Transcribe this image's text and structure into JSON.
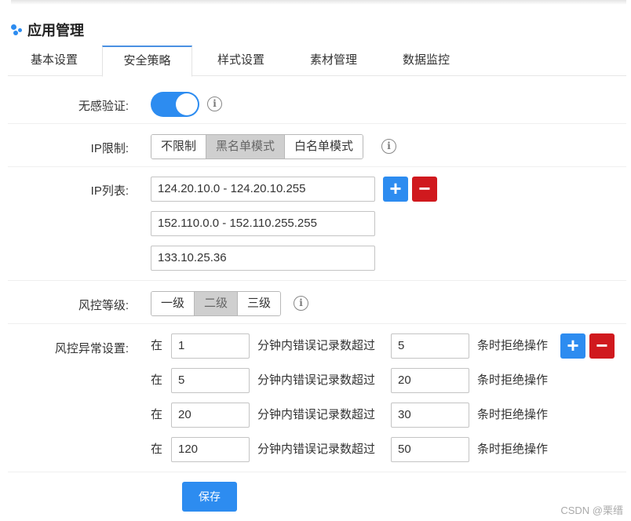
{
  "app": {
    "title": "应用管理"
  },
  "tabs": [
    {
      "label": "基本设置",
      "active": false
    },
    {
      "label": "安全策略",
      "active": true
    },
    {
      "label": "样式设置",
      "active": false
    },
    {
      "label": "素材管理",
      "active": false
    },
    {
      "label": "数据监控",
      "active": false
    }
  ],
  "form": {
    "seamless_verification": {
      "label": "无感验证:",
      "enabled": true
    },
    "ip_restriction": {
      "label": "IP限制:",
      "options": [
        "不限制",
        "黑名单模式",
        "白名单模式"
      ],
      "selected": "黑名单模式"
    },
    "ip_list": {
      "label": "IP列表:",
      "entries": [
        "124.20.10.0 - 124.20.10.255",
        "152.110.0.0 - 152.110.255.255",
        "133.10.25.36"
      ]
    },
    "risk_level": {
      "label": "风控等级:",
      "options": [
        "一级",
        "二级",
        "三级"
      ],
      "selected": "二级"
    },
    "risk_anomaly": {
      "label": "风控异常设置:",
      "prefix": "在",
      "middle": "分钟内错误记录数超过",
      "suffix": "条时拒绝操作",
      "rules": [
        {
          "minutes": "1",
          "count": "5"
        },
        {
          "minutes": "5",
          "count": "20"
        },
        {
          "minutes": "20",
          "count": "30"
        },
        {
          "minutes": "120",
          "count": "50"
        }
      ]
    }
  },
  "actions": {
    "save_label": "保存",
    "add_symbol": "+",
    "remove_symbol": "−"
  },
  "info_symbol": "i",
  "watermark": "CSDN @栗缙",
  "colors": {
    "primary": "#2d8cf0",
    "danger": "#d0191e",
    "selected_segment": "#cfcfcf"
  }
}
